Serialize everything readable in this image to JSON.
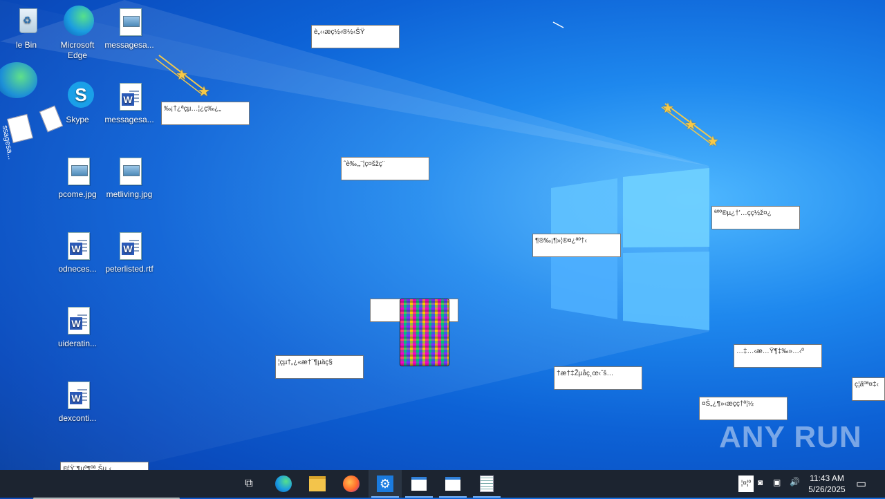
{
  "desktop": {
    "icons": [
      {
        "label": "le Bin",
        "kind": "recycle-bin"
      },
      {
        "label": "Microsoft Edge",
        "kind": "edge"
      },
      {
        "label": "messagesa...",
        "kind": "image"
      },
      {
        "label": "Skype",
        "kind": "skype"
      },
      {
        "label": "messagesa...",
        "kind": "word"
      },
      {
        "label": "pcome.jpg",
        "kind": "image"
      },
      {
        "label": "metliving.jpg",
        "kind": "image"
      },
      {
        "label": "odneces...",
        "kind": "word"
      },
      {
        "label": "peterlisted.rtf",
        "kind": "word"
      },
      {
        "label": "uideratin...",
        "kind": "word"
      },
      {
        "label": "dexconti...",
        "kind": "word"
      }
    ],
    "side_label": "ssagesa..."
  },
  "popups": [
    {
      "text": "è„‹‹æç½‹®½‹ŠŸ"
    },
    {
      "text": "‰¡†¿ªçµ…¦¿ç‰¿„"
    },
    {
      "text": "ˆè‰‚„¨¦ç¤šžç¨"
    },
    {
      "text": "ªºº®µ¿†'…çç½ž¤¿"
    },
    {
      "text": "¶®‰¡¶»¦®¤¿ªº†‹"
    },
    {
      "text": ""
    },
    {
      "text": "¦çµ†„¿«æ†¨¶µäç§"
    },
    {
      "text": "†æ†‡Žµåç¸œ‹ˆš…"
    },
    {
      "text": "…‡…‹æ…Ÿ¶‡‰»…‹º"
    },
    {
      "text": "¤Š„¿¶»‹æçç†ª¦½"
    },
    {
      "text": "ç¦ãºª¤‡‹"
    },
    {
      "text": "®¦Ÿ¨¶µº¶ºª¸Šµ„‹"
    }
  ],
  "watermark": "ANY RUN",
  "taskbar": {
    "apps": [
      {
        "name": "task-view"
      },
      {
        "name": "edge"
      },
      {
        "name": "file-explorer"
      },
      {
        "name": "firefox"
      },
      {
        "name": "settings"
      },
      {
        "name": "window-1"
      },
      {
        "name": "window-2"
      },
      {
        "name": "notepad"
      }
    ],
    "tray_text": "¦¤¦º",
    "time": "11:43 AM",
    "date": "5/26/2025"
  },
  "colors": {
    "accent": "#0d62d6",
    "taskbar": "#1c2430"
  }
}
